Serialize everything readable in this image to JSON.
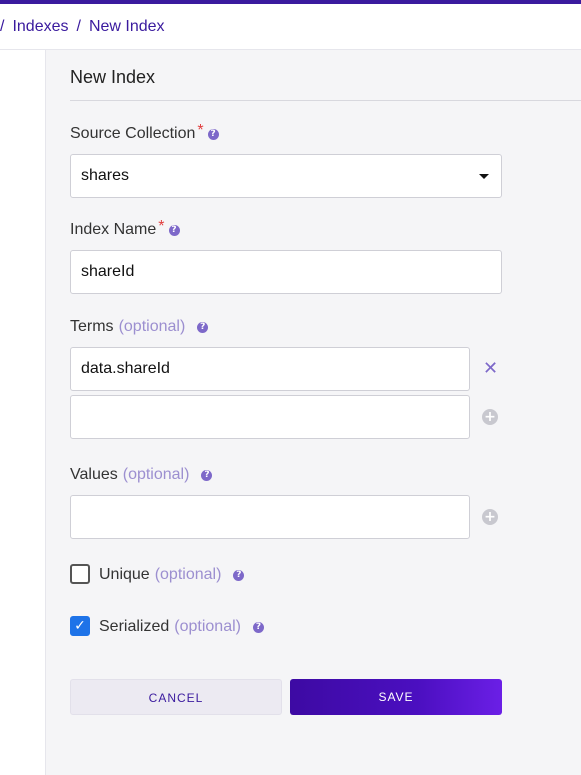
{
  "breadcrumb": {
    "items": [
      "Indexes",
      "New Index"
    ]
  },
  "form": {
    "title": "New Index",
    "source_collection": {
      "label": "Source Collection",
      "value": "shares"
    },
    "index_name": {
      "label": "Index Name",
      "value": "shareId"
    },
    "terms": {
      "label": "Terms",
      "optional": "(optional)",
      "values": [
        "data.shareId",
        ""
      ]
    },
    "values": {
      "label": "Values",
      "optional": "(optional)",
      "values": [
        ""
      ]
    },
    "unique": {
      "label": "Unique",
      "optional": "(optional)",
      "checked": false
    },
    "serialized": {
      "label": "Serialized",
      "optional": "(optional)",
      "checked": true
    },
    "cancel_label": "CANCEL",
    "save_label": "SAVE"
  },
  "colors": {
    "accent": "#3a1a9e",
    "required": "#e03c3c",
    "optional": "#9c8fd0",
    "checkbox_checked": "#1e73e8"
  },
  "icons": {
    "help": "help-icon",
    "remove": "remove-term-icon",
    "add": "add-icon",
    "caret": "chevron-down-icon"
  }
}
